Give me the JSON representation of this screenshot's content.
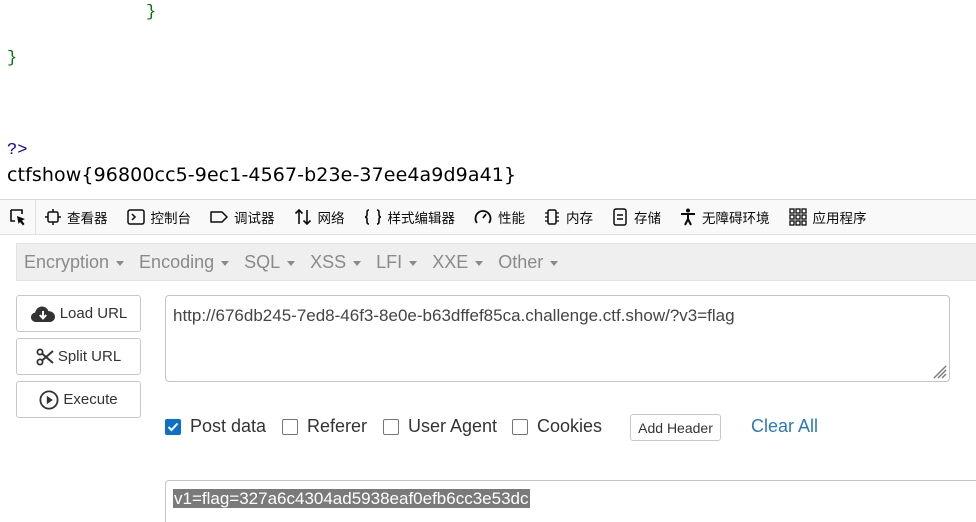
{
  "source": {
    "brace_inner": "}",
    "brace_outer": "}",
    "php_close": "?>",
    "flag_output": "ctfshow{96800cc5-9ec1-4567-b23e-37ee4a9d9a41}"
  },
  "devtools": {
    "tabs": [
      {
        "label": "查看器",
        "icon": "inspector-icon"
      },
      {
        "label": "控制台",
        "icon": "console-icon"
      },
      {
        "label": "调试器",
        "icon": "debugger-icon"
      },
      {
        "label": "网络",
        "icon": "network-icon"
      },
      {
        "label": "样式编辑器",
        "icon": "style-editor-icon"
      },
      {
        "label": "性能",
        "icon": "performance-icon"
      },
      {
        "label": "内存",
        "icon": "memory-icon"
      },
      {
        "label": "存储",
        "icon": "storage-icon"
      },
      {
        "label": "无障碍环境",
        "icon": "accessibility-icon"
      },
      {
        "label": "应用程序",
        "icon": "application-icon"
      }
    ]
  },
  "hackbar": {
    "menu": [
      "Encryption",
      "Encoding",
      "SQL",
      "XSS",
      "LFI",
      "XXE",
      "Other"
    ],
    "buttons": {
      "load": "Load URL",
      "split": "Split URL",
      "execute": "Execute"
    },
    "url": "http://676db245-7ed8-46f3-8e0e-b63dffef85ca.challenge.ctf.show/?v3=flag",
    "options": {
      "post_data": "Post data",
      "referer": "Referer",
      "user_agent": "User Agent",
      "cookies": "Cookies",
      "post_data_checked": true,
      "referer_checked": false,
      "user_agent_checked": false,
      "cookies_checked": false
    },
    "add_header": "Add Header",
    "clear_all": "Clear All",
    "post_body": "v1=flag=327a6c4304ad5938eaf0efb6cc3e53dc"
  },
  "colors": {
    "php_green": "#007700",
    "php_blue": "#0000bb",
    "checkbox_blue": "#0a70c9",
    "link_blue": "#2a7ab8"
  }
}
